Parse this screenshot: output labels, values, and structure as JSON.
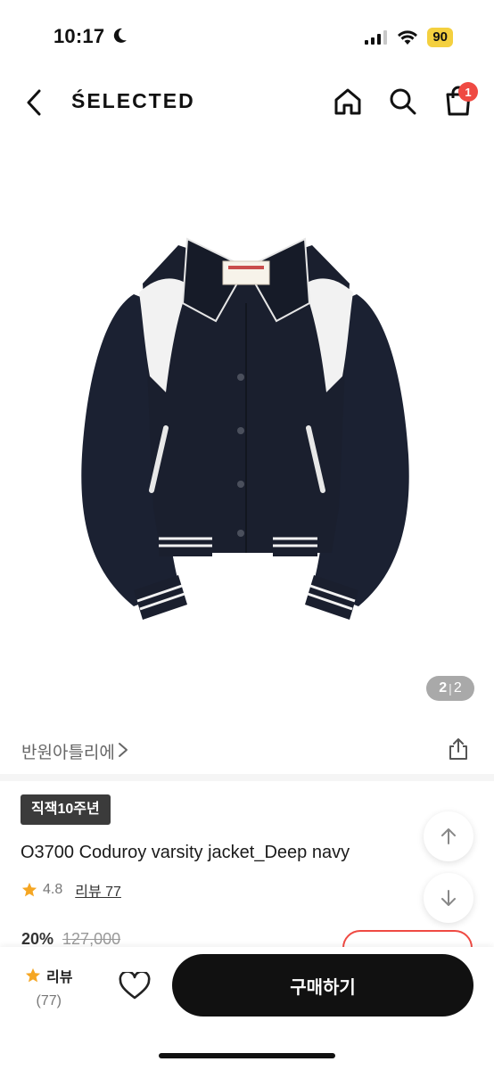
{
  "status": {
    "time": "10:17",
    "battery": "90"
  },
  "nav": {
    "brand": "ŚELECTED",
    "cart_count": "1"
  },
  "gallery": {
    "current_page": "2",
    "total_pages": "2",
    "separator": "|"
  },
  "seller": {
    "name": "반원아틀리에"
  },
  "product": {
    "tag": "직잭10주년",
    "title": "O3700 Coduroy varsity jacket_Deep navy",
    "rating": "4.8",
    "review_label": "리뷰 77",
    "discount": "20%",
    "original_price": "127,000"
  },
  "bottom_bar": {
    "review_label": "리뷰",
    "review_count": "(77)",
    "buy_label": "구매하기"
  },
  "colors": {
    "accent_red": "#ef4a43",
    "star": "#f5a623",
    "jacket_navy": "#1a1f2e"
  }
}
